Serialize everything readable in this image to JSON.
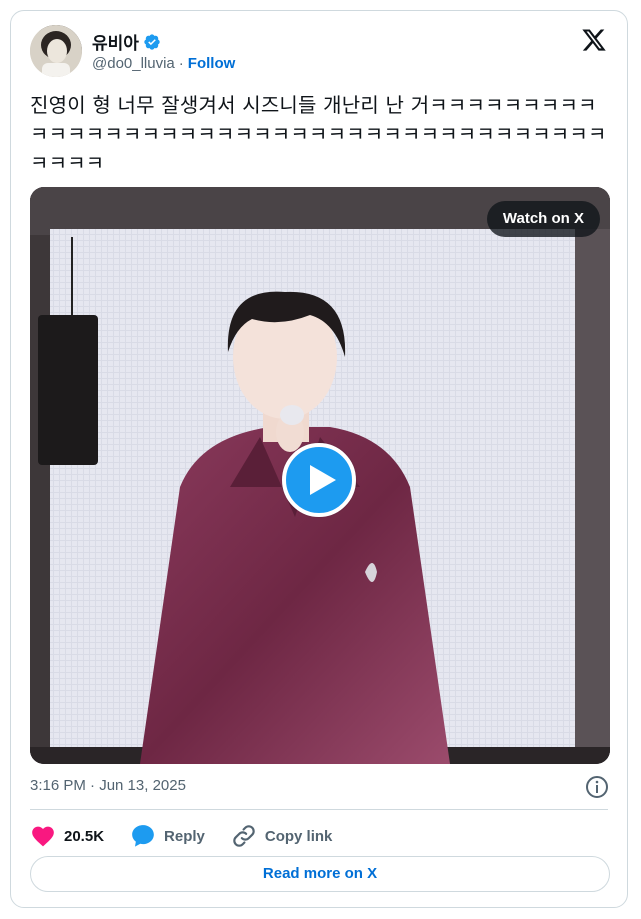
{
  "author": {
    "display_name": "유비아",
    "handle": "@do0_lluvia",
    "separator": "·",
    "follow_label": "Follow"
  },
  "tweet": {
    "text": "진영이 형 너무 잘생겨서 시즈니들 개난리 난 거ㅋㅋㅋㅋㅋㅋㅋㅋㅋㅋㅋㅋㅋㅋㅋㅋㅋㅋㅋㅋㅋㅋㅋㅋㅋㅋㅋㅋㅋㅋㅋㅋㅋㅋㅋㅋㅋㅋㅋㅋㅋㅋㅋㅋ",
    "timestamp": "3:16 PM · Jun 13, 2025"
  },
  "media": {
    "watch_label": "Watch on X",
    "type": "video"
  },
  "actions": {
    "likes_count": "20.5K",
    "reply_label": "Reply",
    "copy_link_label": "Copy link"
  },
  "footer": {
    "read_more_label": "Read more on X"
  },
  "colors": {
    "accent": "#1d9bf0",
    "link": "#006fd6",
    "like": "#f91880",
    "muted": "#536471",
    "border": "#cfd9de"
  },
  "icons": [
    "verified-badge-icon",
    "x-logo-icon",
    "play-icon",
    "info-icon",
    "heart-icon",
    "reply-icon",
    "link-icon"
  ]
}
